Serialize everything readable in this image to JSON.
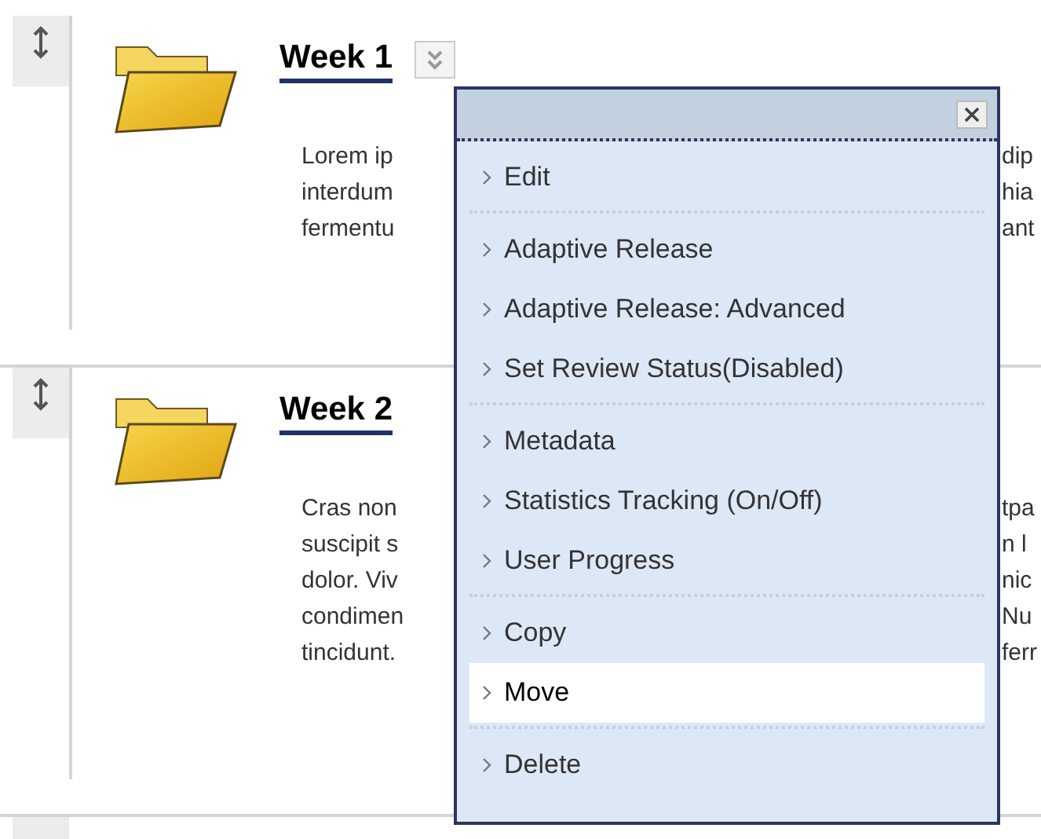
{
  "items": [
    {
      "title": "Week 1",
      "menu_open": true,
      "lines": [
        {
          "left": "Lorem ip",
          "right": "dip"
        },
        {
          "left": "interdum",
          "right": "hia"
        },
        {
          "left": "fermentu",
          "right": "ant"
        }
      ]
    },
    {
      "title": "Week 2",
      "menu_open": false,
      "lines": [
        {
          "left": "Cras non",
          "right": "tpa"
        },
        {
          "left": "suscipit s",
          "right": "n l"
        },
        {
          "left": "dolor. Viv",
          "right": "nic"
        },
        {
          "left": "condimen",
          "right": "Nu"
        },
        {
          "left": "tincidunt.",
          "right": "ferr"
        }
      ]
    }
  ],
  "menu": {
    "groups": [
      {
        "items": [
          {
            "label": "Edit",
            "selected": false
          }
        ]
      },
      {
        "items": [
          {
            "label": "Adaptive Release",
            "selected": false
          },
          {
            "label": "Adaptive Release: Advanced",
            "selected": false
          },
          {
            "label": "Set Review Status(Disabled)",
            "selected": false
          }
        ]
      },
      {
        "items": [
          {
            "label": "Metadata",
            "selected": false
          },
          {
            "label": "Statistics Tracking (On/Off)",
            "selected": false
          },
          {
            "label": "User Progress",
            "selected": false
          }
        ]
      },
      {
        "items": [
          {
            "label": "Copy",
            "selected": false
          },
          {
            "label": "Move",
            "selected": true
          }
        ]
      },
      {
        "items": [
          {
            "label": "Delete",
            "selected": false
          }
        ]
      }
    ]
  }
}
